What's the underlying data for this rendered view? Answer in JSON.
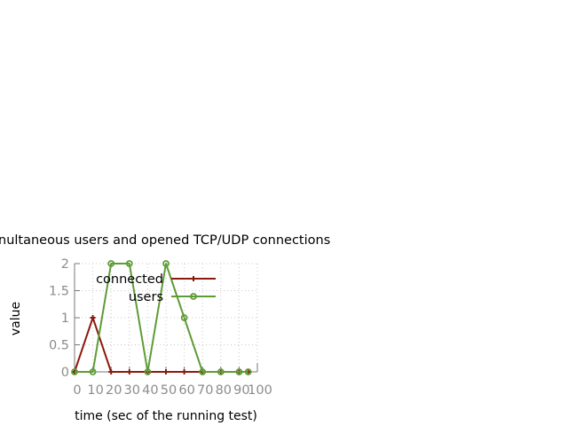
{
  "chart_data": {
    "type": "line",
    "title": "nultaneous users and opened TCP/UDP connections",
    "xlabel": "time (sec of the running test)",
    "ylabel": "value",
    "xlim": [
      0,
      100
    ],
    "ylim": [
      0,
      2
    ],
    "xticks": [
      "0",
      "10",
      "20",
      "30",
      "40",
      "50",
      "60",
      "70",
      "80",
      "90",
      "100"
    ],
    "yticks": [
      "0",
      "0.5",
      "1",
      "1.5",
      "2"
    ],
    "grid": true,
    "legend_position": "top-right",
    "series": [
      {
        "name": "connected",
        "color": "#8b1a0e",
        "marker": "plus",
        "x": [
          0,
          10,
          20,
          30,
          40,
          50,
          60,
          70,
          80,
          90,
          95
        ],
        "y": [
          0,
          1,
          0,
          0,
          0,
          0,
          0,
          0,
          0,
          0,
          0
        ]
      },
      {
        "name": "users",
        "color": "#5e9c36",
        "marker": "circle",
        "x": [
          0,
          10,
          20,
          30,
          40,
          50,
          60,
          70,
          80,
          90,
          95
        ],
        "y": [
          0,
          0,
          2,
          2,
          0,
          2,
          1,
          0,
          0,
          0,
          0
        ]
      }
    ]
  }
}
